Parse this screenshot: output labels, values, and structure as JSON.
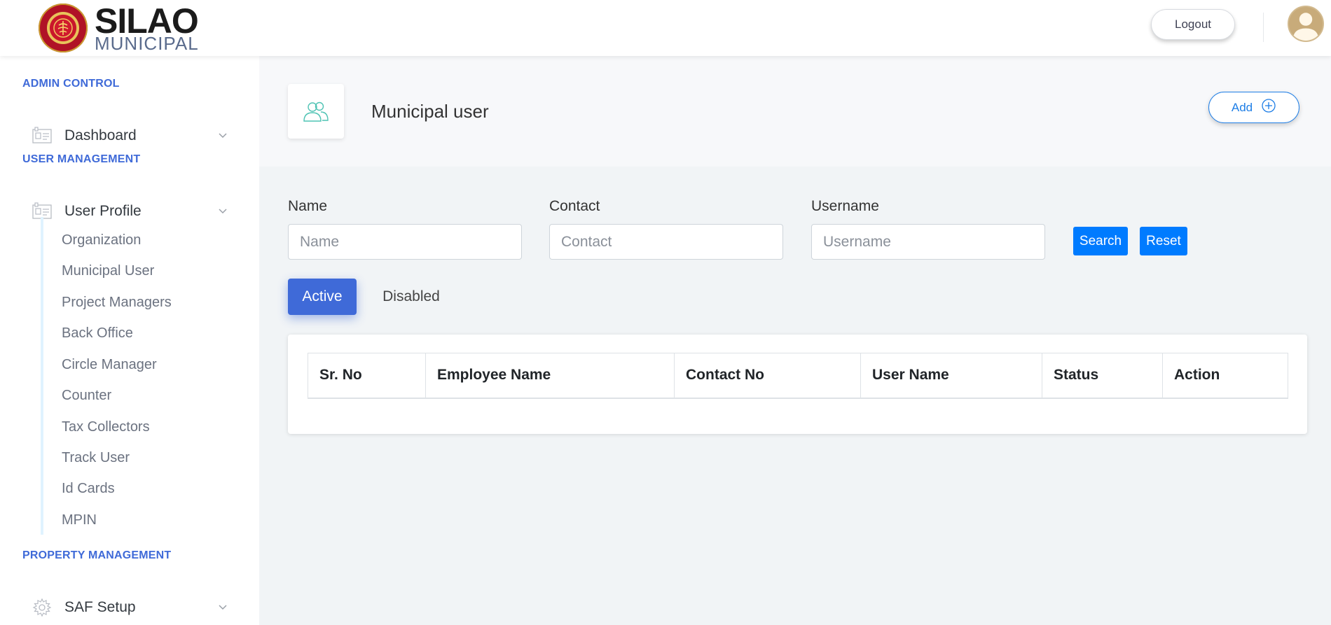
{
  "header": {
    "logo_text_main": "SILAO",
    "logo_text_sub": "MUNICIPAL",
    "logout_label": "Logout"
  },
  "sidebar": {
    "sections": {
      "admin_control": "ADMIN CONTROL",
      "user_management": "USER MANAGEMENT",
      "property_management": "PROPERTY MANAGEMENT"
    },
    "items": {
      "dashboard": "Dashboard",
      "user_profile": "User Profile",
      "saf_setup": "SAF Setup"
    },
    "sub_items": [
      "Organization",
      "Municipal User",
      "Project Managers",
      "Back Office",
      "Circle Manager",
      "Counter",
      "Tax Collectors",
      "Track User",
      "Id Cards",
      "MPIN"
    ]
  },
  "page": {
    "title": "Municipal user",
    "add_label": "Add"
  },
  "filters": {
    "name_label": "Name",
    "name_placeholder": "Name",
    "contact_label": "Contact",
    "contact_placeholder": "Contact",
    "username_label": "Username",
    "username_placeholder": "Username",
    "search_label": "Search",
    "reset_label": "Reset"
  },
  "tabs": {
    "active": "Active",
    "disabled": "Disabled"
  },
  "table": {
    "columns": [
      "Sr. No",
      "Employee Name",
      "Contact No",
      "User Name",
      "Status",
      "Action"
    ],
    "rows": []
  },
  "colors": {
    "accent": "#3f6ad8",
    "button_blue": "#007bff",
    "icon_teal": "#4fc3b4"
  }
}
